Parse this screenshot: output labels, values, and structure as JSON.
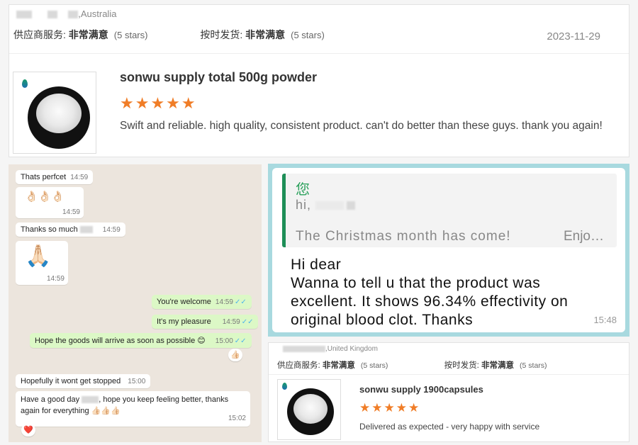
{
  "review_top": {
    "location": ",Australia",
    "supplier_service_label": "供应商服务:",
    "supplier_service_value": "非常满意",
    "supplier_service_stars": "(5 stars)",
    "delivery_label": "按时发货:",
    "delivery_value": "非常满意",
    "delivery_stars": "(5 stars)",
    "date": "2023-11-29",
    "product_title": "sonwu supply total 500g powder",
    "rating": 5,
    "stars_glyph": "★★★★★",
    "comment": "Swift and reliable. high quality, consistent product. can't do better than these guys. thank you again!"
  },
  "whatsapp": {
    "messages": [
      {
        "dir": "in",
        "text": "Thats perfcet",
        "time": "14:59"
      },
      {
        "dir": "in",
        "text": "👌🏻👌🏻👌🏻",
        "time": "14:59"
      },
      {
        "dir": "in",
        "text": "Thanks so much",
        "time": "14:59"
      },
      {
        "dir": "in",
        "text": "🙏🏻",
        "time": "14:59"
      },
      {
        "dir": "out",
        "text": "You're welcome",
        "time": "14:59"
      },
      {
        "dir": "out",
        "text": "It's my pleasure",
        "time": "14:59"
      },
      {
        "dir": "out",
        "text": "Hope the goods will arrive as soon as possible 😊",
        "time": "15:00",
        "reaction": "👍🏻"
      },
      {
        "dir": "in",
        "text": "Hopefully it wont get stopped",
        "time": "15:00"
      },
      {
        "dir": "in",
        "text_line1": "Have a good day",
        "text_line1b": ", hope you keep feeling better, thanks",
        "text_line2": "again for everything 👍🏻👍🏻👍🏻",
        "time": "15:02",
        "reaction": "❤️"
      }
    ]
  },
  "teal_chat": {
    "quote_name": "您",
    "quote_hi": "hi,",
    "quote_text": "The Christmas month has come!",
    "quote_more": "Enjo…",
    "message_lines": [
      "Hi dear",
      "Wanna to tell u that the product was",
      "excellent. It shows 96.34% effectivity on",
      "original blood clot. Thanks"
    ],
    "time": "15:48"
  },
  "review_bottom": {
    "location": ",United Kingdom",
    "supplier_service_label": "供应商服务:",
    "supplier_service_value": "非常满意",
    "supplier_service_stars": "(5 stars)",
    "delivery_label": "按时发货:",
    "delivery_value": "非常满意",
    "delivery_stars": "(5 stars)",
    "product_title": "sonwu supply 1900capsules",
    "rating": 5,
    "stars_glyph": "★★★★★",
    "comment": "Delivered as expected - very happy with service"
  },
  "colors": {
    "star": "#f07d27",
    "whatsapp_bg": "#ece5dd",
    "whatsapp_out": "#dcf8c6",
    "teal_frame": "#a8d9df",
    "quote_bar": "#1e8e57"
  }
}
